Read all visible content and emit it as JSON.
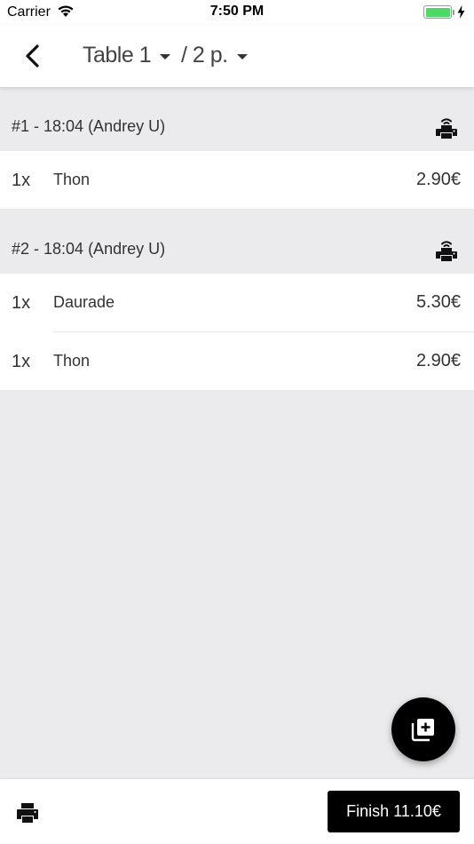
{
  "status_bar": {
    "carrier": "Carrier",
    "time": "7:50 PM",
    "battery_color": "#4cd964"
  },
  "header": {
    "back_icon": "chevron-left-icon",
    "table_label": "Table 1",
    "persons_label": "/ 2 p."
  },
  "orders": [
    {
      "title": "#1 - 18:04 (Andrey U)",
      "print_icon": "printer-icon",
      "items": [
        {
          "qty": "1x",
          "name": "Thon",
          "price": "2.90€"
        }
      ]
    },
    {
      "title": "#2 - 18:04 (Andrey U)",
      "print_icon": "printer-icon",
      "items": [
        {
          "qty": "1x",
          "name": "Daurade",
          "price": "5.30€"
        },
        {
          "qty": "1x",
          "name": "Thon",
          "price": "2.90€"
        }
      ]
    }
  ],
  "fab": {
    "icon": "add-to-queue-icon"
  },
  "bottom_bar": {
    "print_icon": "printer-icon",
    "finish_label": "Finish 11.10€"
  }
}
